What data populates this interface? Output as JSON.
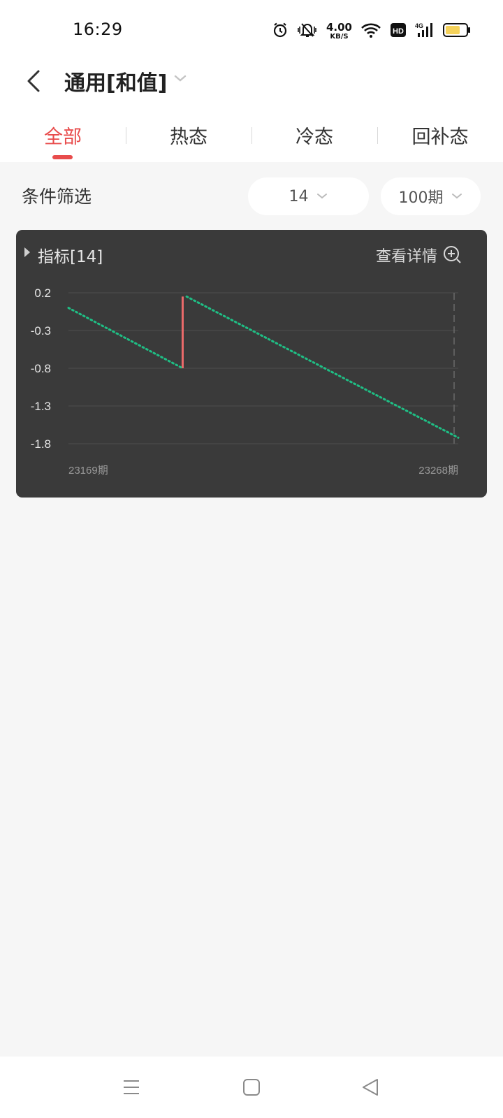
{
  "status_bar": {
    "time": "16:29",
    "net_speed_value": "4.00",
    "net_speed_unit": "KB/S",
    "hd_label": "HD",
    "signal_label": "4G",
    "icons": [
      "alarm-icon",
      "mute-icon",
      "wifi-icon",
      "hd-icon",
      "signal-icon",
      "battery-icon"
    ],
    "battery_color": "#f5d25a"
  },
  "header": {
    "title": "通用[和值]"
  },
  "tabs": [
    {
      "label": "全部",
      "active": true
    },
    {
      "label": "热态",
      "active": false
    },
    {
      "label": "冷态",
      "active": false
    },
    {
      "label": "回补态",
      "active": false
    }
  ],
  "filter": {
    "label": "条件筛选",
    "number_value": "14",
    "period_value": "100期"
  },
  "card": {
    "title": "指标[14]",
    "detail_label": "查看详情"
  },
  "chart_data": {
    "type": "line",
    "x_start_label": "23169期",
    "x_end_label": "23268期",
    "y_tick_labels": [
      "0.2",
      "-0.3",
      "-0.8",
      "-1.3",
      "-1.8"
    ],
    "ylim": [
      -1.8,
      0.2
    ],
    "grid": true,
    "series": [
      {
        "color": "#1fbf85",
        "style": "dotted",
        "points": [
          [
            23169,
            -0.0
          ],
          [
            23198,
            -0.8
          ]
        ]
      },
      {
        "color": "#1fbf85",
        "style": "dotted",
        "points": [
          [
            23199,
            0.15
          ],
          [
            23268,
            -1.72
          ]
        ]
      }
    ],
    "spike": {
      "color": "#ea6a6a",
      "x": 23198,
      "y_from": 0.15,
      "y_to": -0.8
    },
    "dashed_marker_x": 23268
  },
  "colors": {
    "accent": "#e84c4c",
    "card_bg": "#3a3a3a",
    "page_bg": "#f6f6f6"
  },
  "nav": {
    "icons": [
      "menu-icon",
      "home-icon",
      "back-triangle-icon"
    ]
  }
}
